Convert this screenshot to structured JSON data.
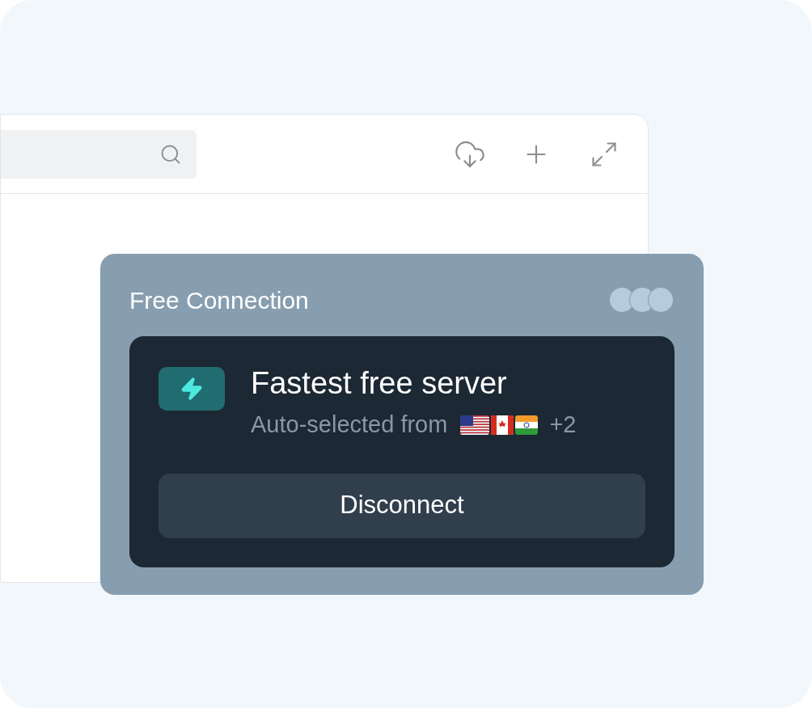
{
  "popup": {
    "title": "Free Connection",
    "server": {
      "name": "Fastest free server",
      "subtitle": "Auto-selected from",
      "more_count": "+2"
    },
    "button": "Disconnect"
  }
}
